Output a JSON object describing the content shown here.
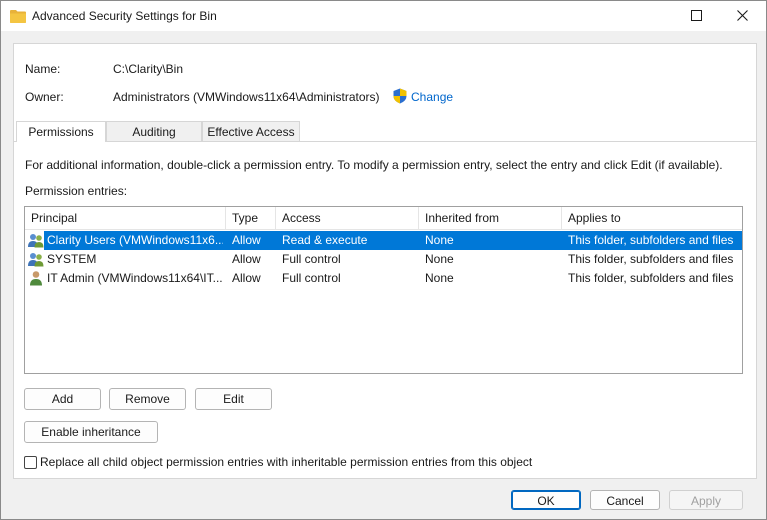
{
  "window": {
    "title": "Advanced Security Settings for Bin",
    "folder_color": "#f4c542"
  },
  "general": {
    "name_label": "Name:",
    "name_value": "C:\\Clarity\\Bin",
    "owner_label": "Owner:",
    "owner_value": "Administrators (VMWindows11x64\\Administrators)",
    "change_link": "Change"
  },
  "tabs": [
    {
      "label": "Permissions",
      "active": true
    },
    {
      "label": "Auditing",
      "active": false
    },
    {
      "label": "Effective Access",
      "active": false
    }
  ],
  "permissions": {
    "info_text": "For additional information, double-click a permission entry. To modify a permission entry, select the entry and click Edit (if available).",
    "entries_label": "Permission entries:",
    "columns": [
      "Principal",
      "Type",
      "Access",
      "Inherited from",
      "Applies to"
    ],
    "rows": [
      {
        "principal": "Clarity Users (VMWindows11x6...",
        "type": "Allow",
        "access": "Read & execute",
        "inherited": "None",
        "applies": "This folder, subfolders and files",
        "icon": "user-group-icon",
        "selected": true
      },
      {
        "principal": "SYSTEM",
        "type": "Allow",
        "access": "Full control",
        "inherited": "None",
        "applies": "This folder, subfolders and files",
        "icon": "user-group-icon",
        "selected": false
      },
      {
        "principal": "IT Admin (VMWindows11x64\\IT...",
        "type": "Allow",
        "access": "Full control",
        "inherited": "None",
        "applies": "This folder, subfolders and files",
        "icon": "user-icon",
        "selected": false
      }
    ],
    "add_button": "Add",
    "remove_button": "Remove",
    "edit_button": "Edit",
    "enable_inheritance_button": "Enable inheritance",
    "replace_checkbox_label": "Replace all child object permission entries with inheritable permission entries from this object",
    "replace_checked": false
  },
  "footer": {
    "ok": "OK",
    "cancel": "Cancel",
    "apply": "Apply"
  },
  "colors": {
    "selection": "#0078d7",
    "link": "#0066cc"
  }
}
